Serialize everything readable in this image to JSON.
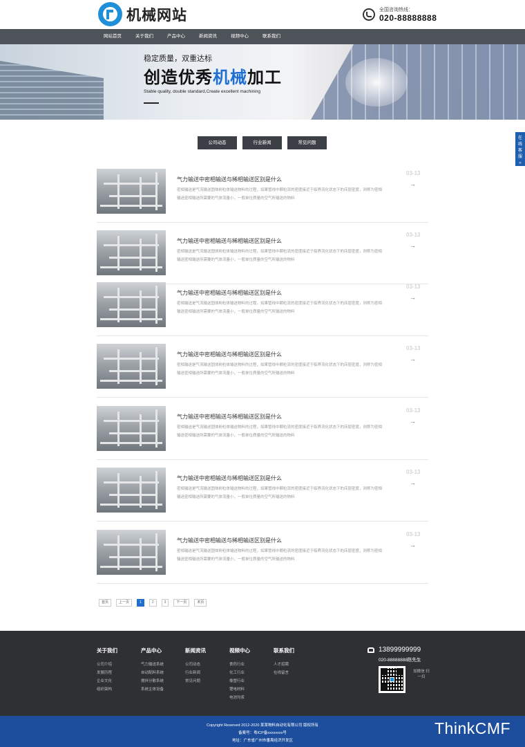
{
  "header": {
    "logo_text": "机械网站",
    "hotline_label": "全国咨询热线：",
    "hotline_number": "020-88888888"
  },
  "nav": {
    "items": [
      "网站首页",
      "关于我们",
      "产品中心",
      "新闻资讯",
      "视频中心",
      "联系我们"
    ]
  },
  "banner": {
    "subtitle": "稳定质量，双重达标",
    "title_part1": "创造优秀",
    "title_accent": "机械",
    "title_part2": "加工",
    "english": "Stable quality, double standard,Create excellent machining"
  },
  "tabs": [
    "公司动态",
    "行业新闻",
    "常见问题"
  ],
  "side_float": "在线客服",
  "side_float_icon": "«",
  "news": {
    "items": [
      {
        "title": "气力输送中密相输送与稀相输送区别是什么",
        "desc": "密相输送是气流输送固体粉粒体输送物料的过程，如果管线中颗粒流的密度接近于临界流化状态下的床层密度，则称为密相输送密相输送所需要的气体流量小，一般单位质量的空气所输送的物料",
        "date": "03-13",
        "arrow": "→"
      },
      {
        "title": "气力输送中密相输送与稀相输送区别是什么",
        "desc": "密相输送是气流输送固体粉粒体输送物料的过程，如果管线中颗粒流的密度接近于临界流化状态下的床层密度，则称为密相输送密相输送所需要的气体流量小，一般单位质量的空气所输送的物料",
        "date": "03-13",
        "arrow": "→"
      },
      {
        "title": "气力输送中密相输送与稀相输送区别是什么",
        "desc": "密相输送是气流输送固体粉粒体输送物料的过程，如果管线中颗粒流的密度接近于临界流化状态下的床层密度，则称为密相输送密相输送所需要的气体流量小，一般单位质量的空气所输送的物料",
        "date": "03-13",
        "arrow": "→"
      },
      {
        "title": "气力输送中密相输送与稀相输送区别是什么",
        "desc": "密相输送是气流输送固体粉粒体输送物料的过程，如果管线中颗粒流的密度接近于临界流化状态下的床层密度，则称为密相输送密相输送所需要的气体流量小，一般单位质量的空气所输送的物料",
        "date": "03-13",
        "arrow": "→"
      },
      {
        "title": "气力输送中密相输送与稀相输送区别是什么",
        "desc": "密相输送是气流输送固体粉粒体输送物料的过程，如果管线中颗粒流的密度接近于临界流化状态下的床层密度，则称为密相输送密相输送所需要的气体流量小，一般单位质量的空气所输送的物料",
        "date": "03-13",
        "arrow": "→"
      },
      {
        "title": "气力输送中密相输送与稀相输送区别是什么",
        "desc": "密相输送是气流输送固体粉粒体输送物料的过程，如果管线中颗粒流的密度接近于临界流化状态下的床层密度，则称为密相输送密相输送所需要的气体流量小，一般单位质量的空气所输送的物料",
        "date": "03-13",
        "arrow": "→"
      },
      {
        "title": "气力输送中密相输送与稀相输送区别是什么",
        "desc": "密相输送是气流输送固体粉粒体输送物料的过程，如果管线中颗粒流的密度接近于临界流化状态下的床层密度，则称为密相输送密相输送所需要的气体流量小，一般单位质量的空气所输送的物料",
        "date": "03-13",
        "arrow": "→"
      }
    ]
  },
  "pagination": {
    "first": "首页",
    "prev": "上一页",
    "pages": [
      "1",
      "2",
      "3"
    ],
    "current": "1",
    "next": "下一页",
    "last": "末页"
  },
  "footer": {
    "columns": [
      {
        "title": "关于我们",
        "links": [
          "公司介绍",
          "发展历程",
          "企业文化",
          "组织架构"
        ]
      },
      {
        "title": "产品中心",
        "links": [
          "气力输送系统",
          "自动配料系统",
          "搅拌分散系统",
          "系统主体设备"
        ]
      },
      {
        "title": "新闻资讯",
        "links": [
          "公司动态",
          "行业新闻",
          "常见问题"
        ]
      },
      {
        "title": "视频中心",
        "links": [
          "食药行业",
          "化工行业",
          "橡塑行业",
          "锂电材料",
          "电池均浆"
        ]
      },
      {
        "title": "联系我们",
        "links": [
          "人才招聘",
          "在线留言"
        ]
      }
    ],
    "phone": "13899999999",
    "contact": "020-88888888陈先生",
    "qr_text": "加微信 扫一扫"
  },
  "copyright": {
    "line1": "Copyright Reserved 2012-2020 某某物料自动化有限公司 版权所有",
    "line2": "备案号：粤ICP备xxxxxxxx号",
    "line3": "地址：广东省广州市番禺经济开发区"
  },
  "watermark": "ThinkCMF",
  "colors": {
    "accent": "#1f6fd0",
    "nav_bg": "#4e535a",
    "footer_bg": "#2e3033",
    "copy_bg": "#1d4e9d"
  }
}
